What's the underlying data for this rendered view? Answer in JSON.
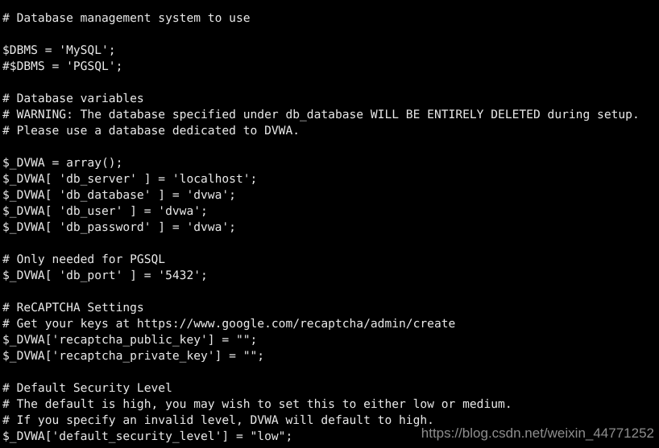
{
  "app": {
    "kind": "terminal-text-view",
    "background_color": "#000000",
    "text_color": "#e8e8e8",
    "watermark_color": "#8e8e8e",
    "font_size_px": 14.6,
    "line_height_px": 20
  },
  "file": {
    "description": "DVWA config.inc.php configuration file contents",
    "lines": [
      "# Database management system to use",
      "",
      "$DBMS = 'MySQL';",
      "#$DBMS = 'PGSQL';",
      "",
      "# Database variables",
      "# WARNING: The database specified under db_database WILL BE ENTIRELY DELETED during setup.",
      "# Please use a database dedicated to DVWA.",
      "",
      "$_DVWA = array();",
      "$_DVWA[ 'db_server' ] = 'localhost';",
      "$_DVWA[ 'db_database' ] = 'dvwa';",
      "$_DVWA[ 'db_user' ] = 'dvwa';",
      "$_DVWA[ 'db_password' ] = 'dvwa';",
      "",
      "# Only needed for PGSQL",
      "$_DVWA[ 'db_port' ] = '5432';",
      "",
      "# ReCAPTCHA Settings",
      "# Get your keys at https://www.google.com/recaptcha/admin/create",
      "$_DVWA['recaptcha_public_key'] = \"\";",
      "$_DVWA['recaptcha_private_key'] = \"\";",
      "",
      "# Default Security Level",
      "# The default is high, you may wish to set this to either low or medium.",
      "# If you specify an invalid level, DVWA will default to high.",
      "$_DVWA['default_security_level'] = \"low\";"
    ]
  },
  "watermark": {
    "text": "https://blog.csdn.net/weixin_44771252"
  }
}
